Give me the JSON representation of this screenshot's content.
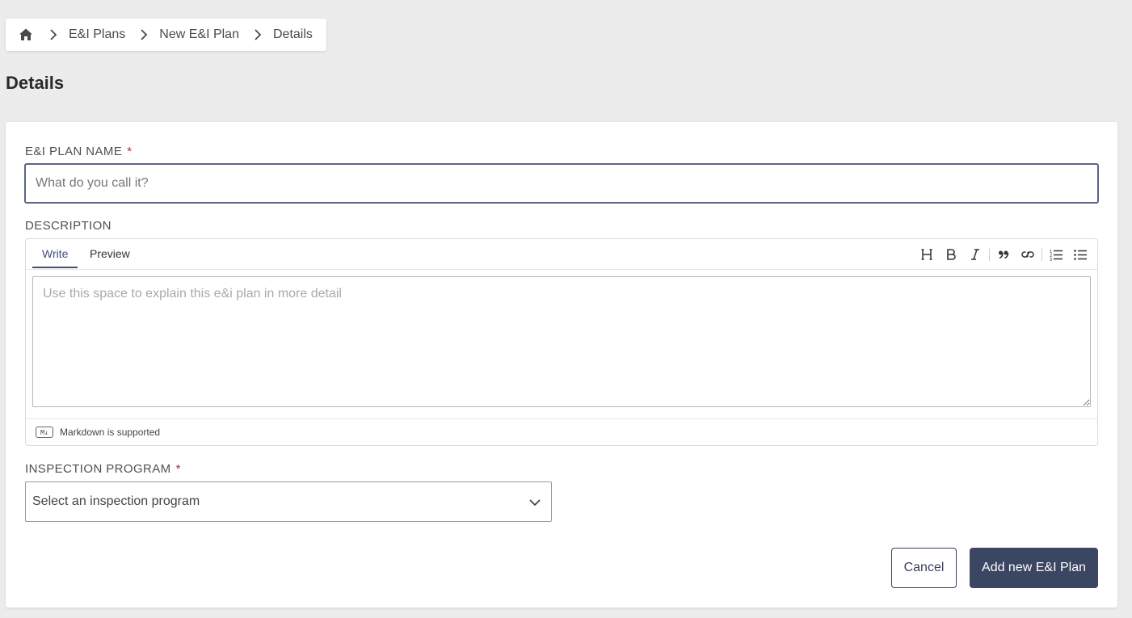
{
  "breadcrumb": {
    "home_icon": "home-icon",
    "items": [
      "E&I Plans",
      "New E&I Plan",
      "Details"
    ]
  },
  "page": {
    "title": "Details"
  },
  "form": {
    "name_label": "E&I PLAN NAME",
    "required_mark": "*",
    "name_placeholder": "What do you call it?",
    "name_value": "",
    "description_label": "DESCRIPTION",
    "editor": {
      "tabs": [
        "Write",
        "Preview"
      ],
      "active_tab": "Write",
      "toolbar": [
        "heading-icon",
        "bold-icon",
        "italic-icon",
        "quote-icon",
        "link-icon",
        "ordered-list-icon",
        "unordered-list-icon"
      ],
      "placeholder": "Use this space to explain this e&i plan in more detail",
      "markdown_badge": "M↓",
      "markdown_note": "Markdown is supported"
    },
    "program_label": "INSPECTION PROGRAM",
    "program_placeholder": "Select an inspection program"
  },
  "actions": {
    "cancel": "Cancel",
    "submit": "Add new E&I Plan"
  },
  "colors": {
    "accent": "#3b4663",
    "active_tab": "#40507a",
    "required": "#aa3333",
    "background": "#ececec"
  }
}
